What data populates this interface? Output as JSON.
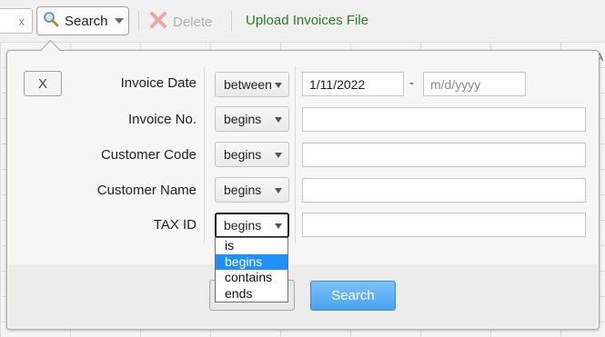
{
  "toolbar": {
    "clear_label": "x",
    "search_label": "Search",
    "delete_label": "Delete",
    "upload_label": "Upload Invoices File"
  },
  "panel": {
    "close_label": "X",
    "fields": [
      {
        "label": "Invoice Date",
        "operator": "between",
        "value_from": "1/11/2022",
        "value_to_placeholder": "m/d/yyyy"
      },
      {
        "label": "Invoice No.",
        "operator": "begins",
        "value": ""
      },
      {
        "label": "Customer Code",
        "operator": "begins",
        "value": ""
      },
      {
        "label": "Customer Name",
        "operator": "begins",
        "value": ""
      },
      {
        "label": "TAX ID",
        "operator": "begins",
        "value": ""
      }
    ],
    "range_separator": "-",
    "operator_dropdown": {
      "options": [
        "is",
        "begins",
        "contains",
        "ends"
      ],
      "selected": "begins"
    },
    "search_button_label": "Search"
  },
  "edge_text": "A",
  "colors": {
    "upload_link": "#2a7d25",
    "selected_option": "#1e90ff",
    "search_button": "#4aa3ee"
  }
}
